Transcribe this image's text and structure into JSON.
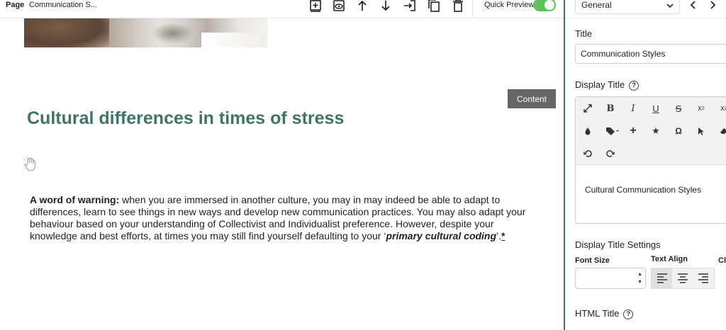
{
  "topbar": {
    "page_label": "Page",
    "page_name": "Communication S...",
    "quick_preview_label": "Quick Preview",
    "quick_preview_on": true
  },
  "canvas": {
    "content_tag": "Content",
    "heading": "Cultural differences in times of stress",
    "paragraph": {
      "bold_lead": "A word of warning:",
      "text": " when you are immersed in another culture, you may in may indeed be able to adapt to differences, learn to see things in new ways and develop new communication practices. You may also adapt your behaviour based on your understanding of Collectivist and Individualist preference. However, despite your knowledge and best efforts, at times you may still find yourself defaulting to your ‘",
      "emphasis": "primary cultural coding",
      "tail": "’.",
      "footnote_marker": "*"
    }
  },
  "panel": {
    "view_select": "General",
    "title_label": "Title",
    "title_value": "Communication Styles",
    "display_title_label": "Display Title",
    "display_title_value": "Cultural Communication Styles",
    "display_title_settings_label": "Display Title Settings",
    "font_size_label": "Font Size",
    "text_align_label": "Text Align",
    "clipped_label": "Cl",
    "html_title_label": "HTML Title"
  },
  "colors": {
    "heading": "#3f7566",
    "toggle_on": "#5ec25e",
    "panel_border": "#2b6f9e"
  }
}
